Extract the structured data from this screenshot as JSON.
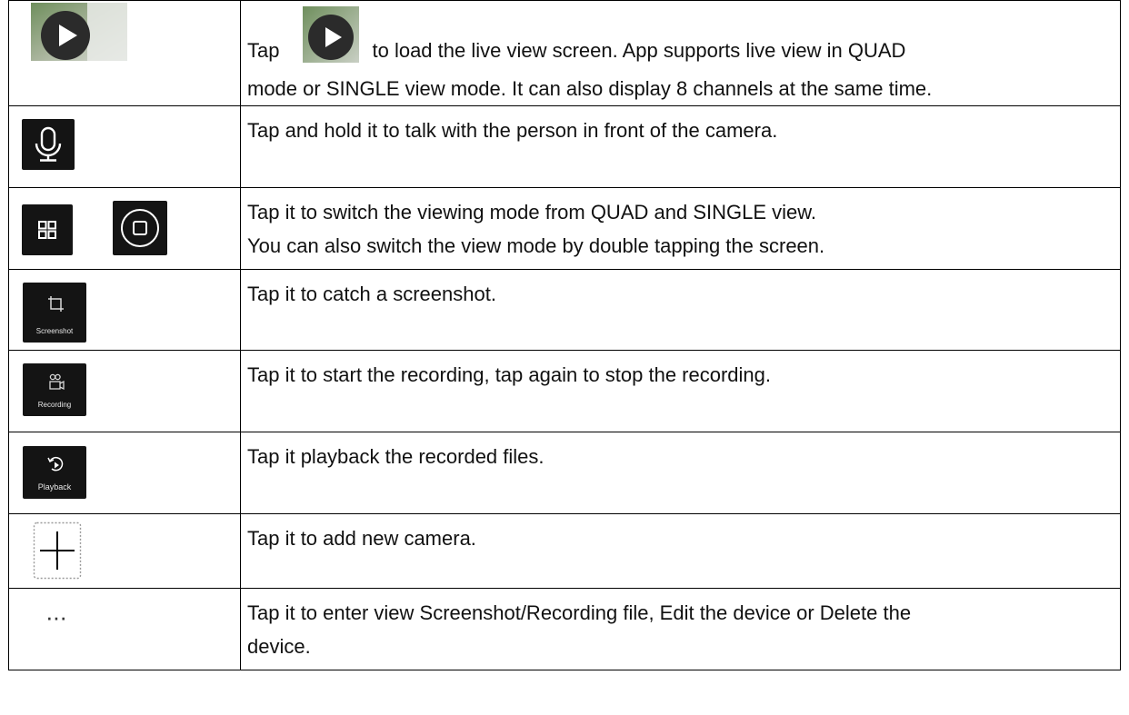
{
  "rows": [
    {
      "icon": "live-play-icon",
      "line1_prefix": "Tap",
      "line1_suffix": "to load the live view screen. App supports live view in QUAD",
      "line2": "mode or SINGLE view mode. It can also display 8 channels at the same time."
    },
    {
      "icon": "microphone-icon",
      "line1": "Tap and hold it to talk with the person in front of the camera."
    },
    {
      "icons": [
        "quad-view-icon",
        "single-view-icon"
      ],
      "line1": "Tap it to switch the viewing mode from QUAD and SINGLE view.",
      "line2": "You can also switch the view mode by double tapping the screen."
    },
    {
      "icon": "screenshot-icon",
      "icon_label": "Screenshot",
      "line1": "Tap it to catch a screenshot."
    },
    {
      "icon": "recording-icon",
      "icon_label": "Recording",
      "line1": "Tap it to start the recording, tap again to stop the recording."
    },
    {
      "icon": "playback-icon",
      "icon_label": "Playback",
      "line1": "Tap it playback the recorded files."
    },
    {
      "icon": "add-camera-icon",
      "line1": "Tap it to add new camera."
    },
    {
      "icon": "more-icon",
      "icon_text": "···",
      "line1": "Tap it to enter view Screenshot/Recording file, Edit the device or Delete the",
      "line2": "device."
    }
  ],
  "colors": {
    "tile_background": "#141414",
    "play_circle": "#2b2b2b",
    "photo_green": "#7f9a69",
    "border": "#000000"
  }
}
